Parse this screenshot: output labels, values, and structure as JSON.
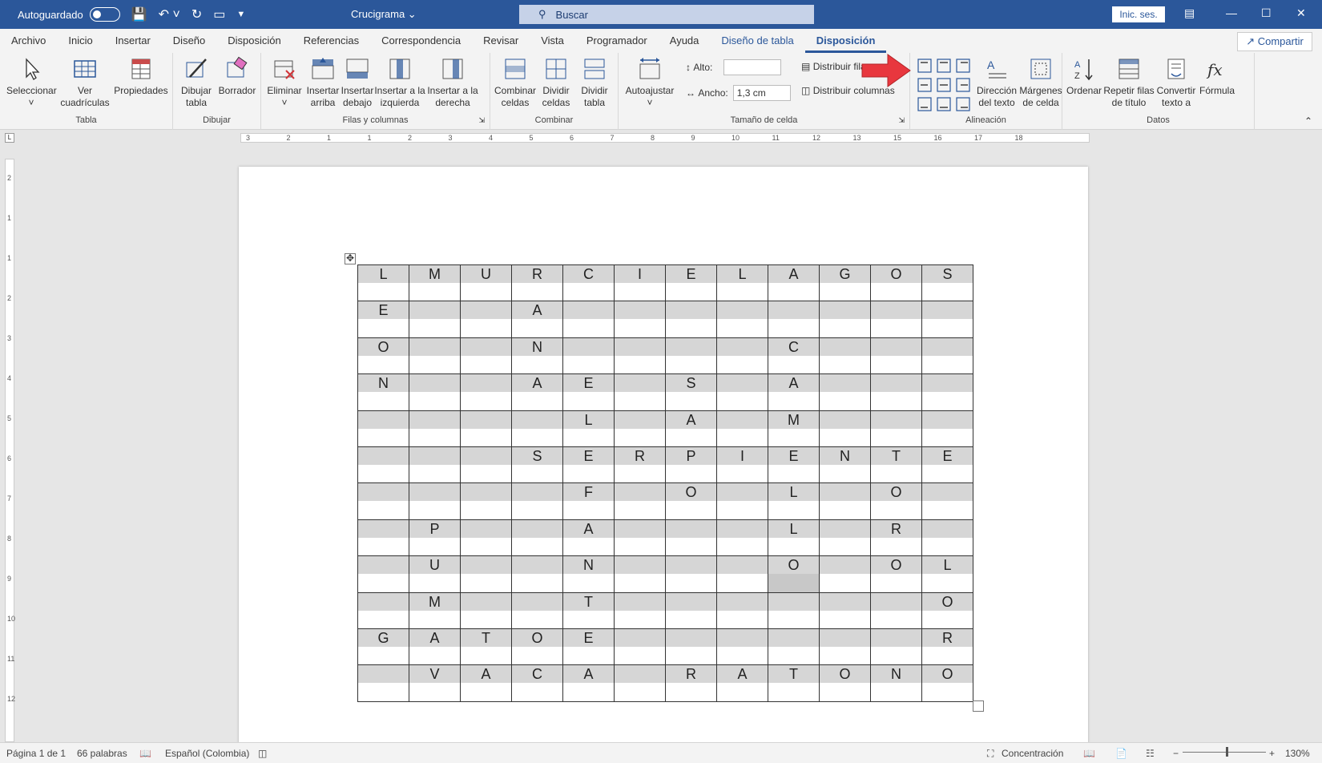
{
  "titlebar": {
    "autosave_label": "Autoguardado",
    "doc_title": "Crucigrama ⌄",
    "search_placeholder": "Buscar",
    "signin_label": "Inic. ses."
  },
  "menu": {
    "tabs": [
      "Archivo",
      "Inicio",
      "Insertar",
      "Diseño",
      "Disposición",
      "Referencias",
      "Correspondencia",
      "Revisar",
      "Vista",
      "Programador",
      "Ayuda",
      "Diseño de tabla",
      "Disposición"
    ],
    "share_label": "Compartir"
  },
  "ribbon": {
    "tabla": {
      "label": "Tabla",
      "seleccionar": "Seleccionar",
      "ver": "Ver cuadrículas",
      "propiedades": "Propiedades"
    },
    "dibujar": {
      "label": "Dibujar",
      "dibujar_tabla": "Dibujar tabla",
      "borrador": "Borrador"
    },
    "filas": {
      "label": "Filas y columnas",
      "eliminar": "Eliminar",
      "arriba": "Insertar arriba",
      "debajo": "Insertar debajo",
      "izquierda": "Insertar a la izquierda",
      "derecha": "Insertar a la derecha"
    },
    "combinar": {
      "label": "Combinar",
      "combinar_celdas": "Combinar celdas",
      "dividir_celdas": "Dividir celdas",
      "dividir_tabla": "Dividir tabla"
    },
    "tamano": {
      "label": "Tamaño de celda",
      "autoajustar": "Autoajustar",
      "alto_label": "Alto:",
      "alto_value": "",
      "ancho_label": "Ancho:",
      "ancho_value": "1,3 cm",
      "distribuir_filas": "Distribuir filas",
      "distribuir_columnas": "Distribuir columnas"
    },
    "alineacion": {
      "label": "Alineación",
      "direccion": "Dirección del texto",
      "margenes": "Márgenes de celda"
    },
    "datos": {
      "label": "Datos",
      "ordenar": "Ordenar",
      "repetir": "Repetir filas de título",
      "convertir": "Convertir texto a",
      "formula": "Fórmula"
    }
  },
  "crossword": [
    [
      "L",
      "M",
      "U",
      "R",
      "C",
      "I",
      "E",
      "L",
      "A",
      "G",
      "O",
      "S"
    ],
    [
      "E",
      "",
      "",
      "A",
      "",
      "",
      "",
      "",
      "",
      "",
      "",
      ""
    ],
    [
      "O",
      "",
      "",
      "N",
      "",
      "",
      "",
      "",
      "C",
      "",
      "",
      ""
    ],
    [
      "N",
      "",
      "",
      "A",
      "E",
      "",
      "S",
      "",
      "A",
      "",
      "",
      ""
    ],
    [
      "",
      "",
      "",
      "",
      "L",
      "",
      "A",
      "",
      "M",
      "",
      "",
      ""
    ],
    [
      "",
      "",
      "",
      "S",
      "E",
      "R",
      "P",
      "I",
      "E",
      "N",
      "T",
      "E"
    ],
    [
      "",
      "",
      "",
      "",
      "F",
      "",
      "O",
      "",
      "L",
      "",
      "O",
      ""
    ],
    [
      "",
      "P",
      "",
      "",
      "A",
      "",
      "",
      "",
      "L",
      "",
      "R",
      ""
    ],
    [
      "",
      "U",
      "",
      "",
      "N",
      "",
      "",
      "",
      "O",
      "",
      "O",
      "L"
    ],
    [
      "",
      "M",
      "",
      "",
      "T",
      "",
      "",
      "",
      "",
      "",
      "",
      "O"
    ],
    [
      "G",
      "A",
      "T",
      "O",
      "E",
      "",
      "",
      "",
      "",
      "",
      "",
      "R"
    ],
    [
      "",
      "V",
      "A",
      "C",
      "A",
      "",
      "R",
      "A",
      "T",
      "O",
      "N",
      "O"
    ]
  ],
  "ruler": {
    "h_marks": [
      "3",
      "2",
      "1",
      "1",
      "2",
      "3",
      "4",
      "5",
      "6",
      "7",
      "8",
      "9",
      "10",
      "11",
      "12",
      "13",
      "15",
      "16",
      "17",
      "18"
    ],
    "v_marks": [
      "2",
      "1",
      "1",
      "2",
      "3",
      "4",
      "5",
      "6",
      "7",
      "8",
      "9",
      "10",
      "11",
      "12"
    ]
  },
  "status": {
    "page": "Página 1 de 1",
    "words": "66 palabras",
    "language": "Español (Colombia)",
    "focus": "Concentración",
    "zoom": "130%"
  }
}
